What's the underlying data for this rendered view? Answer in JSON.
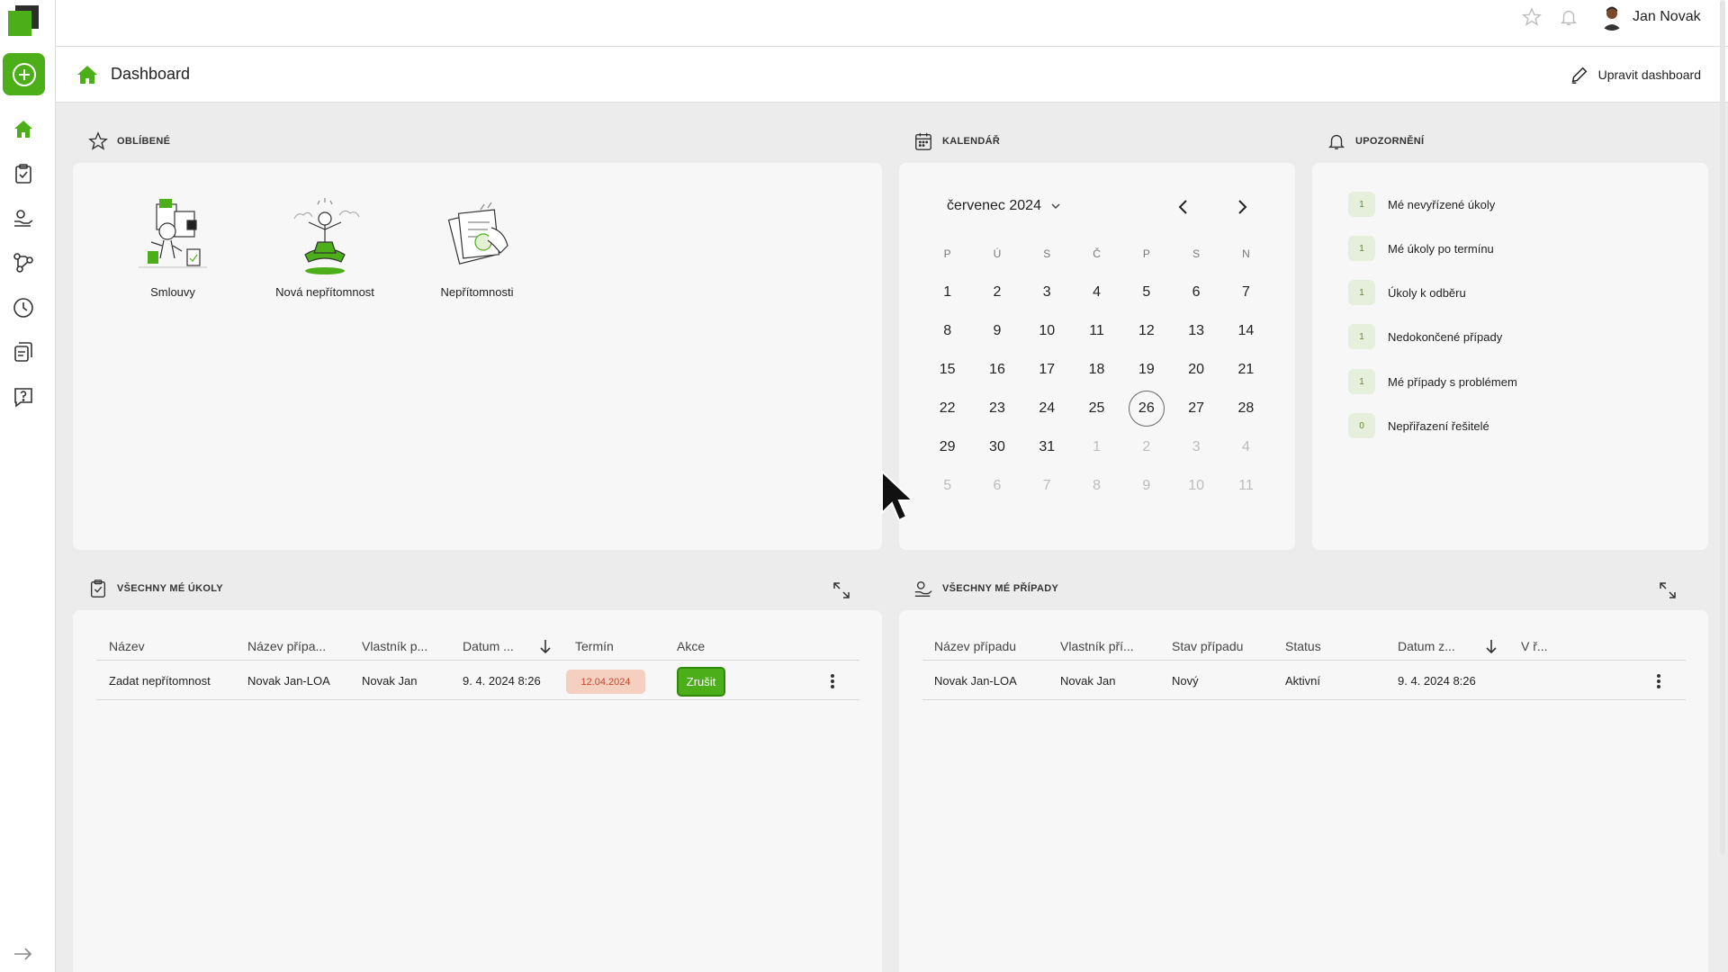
{
  "colors": {
    "accent": "#4caf1a",
    "deadline_bg": "#f5cfc0",
    "deadline_text": "#c24a2a",
    "badge_bg": "#e6efdc"
  },
  "topbar": {
    "user_name": "Jan Novak"
  },
  "title": {
    "page": "Dashboard",
    "edit_label": "Upravit dashboard"
  },
  "sections": {
    "favorites": "OBLÍBENÉ",
    "calendar": "KALENDÁŘ",
    "notifications": "UPOZORNĚNÍ",
    "tasks": "VŠECHNY MÉ ÚKOLY",
    "cases": "VŠECHNY MÉ PŘÍPADY"
  },
  "favorites": [
    {
      "label": "Smlouvy",
      "icon": "contracts-illustration"
    },
    {
      "label": "Nová nepřítomnost",
      "icon": "meditation-illustration"
    },
    {
      "label": "Nepřítomnosti",
      "icon": "documents-illustration"
    }
  ],
  "calendar": {
    "month_label": "červenec 2024",
    "weekdays": [
      "P",
      "Ú",
      "S",
      "Č",
      "P",
      "S",
      "N"
    ],
    "today": "26",
    "weeks": [
      [
        "1",
        "2",
        "3",
        "4",
        "5",
        "6",
        "7"
      ],
      [
        "8",
        "9",
        "10",
        "11",
        "12",
        "13",
        "14"
      ],
      [
        "15",
        "16",
        "17",
        "18",
        "19",
        "20",
        "21"
      ],
      [
        "22",
        "23",
        "24",
        "25",
        "26",
        "27",
        "28"
      ],
      [
        "29",
        "30",
        "31",
        "1",
        "2",
        "3",
        "4"
      ],
      [
        "5",
        "6",
        "7",
        "8",
        "9",
        "10",
        "11"
      ]
    ]
  },
  "notifications": [
    {
      "count": "1",
      "label": "Mé nevyřízené úkoly"
    },
    {
      "count": "1",
      "label": "Mé úkoly po termínu"
    },
    {
      "count": "1",
      "label": "Úkoly k odběru"
    },
    {
      "count": "1",
      "label": "Nedokončené případy"
    },
    {
      "count": "1",
      "label": "Mé případy s problémem"
    },
    {
      "count": "0",
      "label": "Nepřiřazení řešitelé"
    }
  ],
  "tasks": {
    "columns": [
      "Název",
      "Název přípa...",
      "Vlastník p...",
      "Datum ...",
      "Termín",
      "Akce"
    ],
    "rows": [
      {
        "name": "Zadat nepřítomnost",
        "case_name": "Novak Jan-LOA",
        "owner": "Novak Jan",
        "date": "9. 4. 2024 8:26",
        "deadline": "12.04.2024",
        "action": "Zrušit"
      }
    ]
  },
  "cases": {
    "columns": [
      "Název případu",
      "Vlastník pří...",
      "Stav případu",
      "Status",
      "Datum z...",
      "V ř..."
    ],
    "rows": [
      {
        "name": "Novak Jan-LOA",
        "owner": "Novak Jan",
        "state": "Nový",
        "status": "Aktivní",
        "date": "9. 4. 2024 8:26"
      }
    ]
  }
}
